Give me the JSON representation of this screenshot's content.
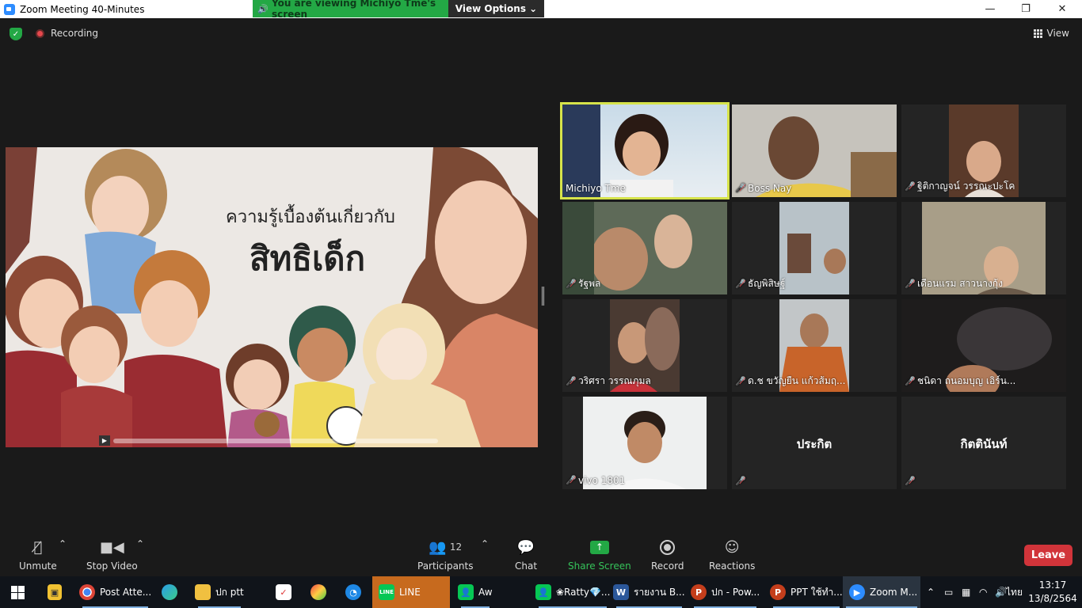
{
  "window": {
    "title": "Zoom Meeting 40-Minutes",
    "minimize": "—",
    "restore": "❐",
    "close": "✕"
  },
  "banner": {
    "viewing_text": "You are viewing Michiyo Tme's screen",
    "view_options": "View Options ⌄"
  },
  "topbar": {
    "recording": "Recording",
    "view": "View"
  },
  "slide": {
    "line1": "ความรู้เบื้องต้นเกี่ยวกับ",
    "line2": "สิทธิเด็ก"
  },
  "participants": [
    {
      "name": "Michiyo Tme",
      "muted": false,
      "active": true
    },
    {
      "name": "Boss Nay",
      "muted": true
    },
    {
      "name": "ฐิติกาญจน์ วรรณะปะโค",
      "muted": true
    },
    {
      "name": "รัฐพล",
      "muted": true
    },
    {
      "name": "ธัญพิสิษฐ์",
      "muted": true
    },
    {
      "name": "เดือนแรม สาวนางกุ้ง",
      "muted": true
    },
    {
      "name": "วริศรา  วรรณภุมล",
      "muted": true
    },
    {
      "name": "ด.ช ขวัญยืน แก้วส้มฤ...",
      "muted": true
    },
    {
      "name": "ชนิดา ถนอมบุญ เอิร์น...",
      "muted": true
    },
    {
      "name": "vivo 1801",
      "muted": true
    },
    {
      "name": "ประกิต",
      "muted": true,
      "no_video": true
    },
    {
      "name": "กิตตินันท์",
      "muted": true,
      "no_video": true
    }
  ],
  "controls": {
    "unmute": "Unmute",
    "stop_video": "Stop Video",
    "participants": "Participants",
    "participants_count": "12",
    "chat": "Chat",
    "share_screen": "Share Screen",
    "record": "Record",
    "reactions": "Reactions",
    "leave": "Leave"
  },
  "taskbar": {
    "items": [
      {
        "label": "Post Atte...",
        "icon": "chrome-icon"
      },
      {
        "label": "ปก ptt",
        "icon": "folder-icon"
      },
      {
        "label": "LINE",
        "icon": "line-icon"
      },
      {
        "label": "Aw",
        "icon": "contact-icon"
      },
      {
        "label": "❀Ratty💎...",
        "icon": "contact-icon"
      },
      {
        "label": "รายงาน B...",
        "icon": "word-icon"
      },
      {
        "label": "ปก - Pow...",
        "icon": "powerpoint-icon"
      },
      {
        "label": "PPT ใช้ทำ...",
        "icon": "powerpoint-icon"
      },
      {
        "label": "Zoom M...",
        "icon": "zoom-icon"
      }
    ],
    "line_badge": "LINE",
    "word_badge": "W",
    "ppt_badge": "P",
    "lang": "ไทย",
    "time": "13:17",
    "date": "13/8/2564"
  }
}
